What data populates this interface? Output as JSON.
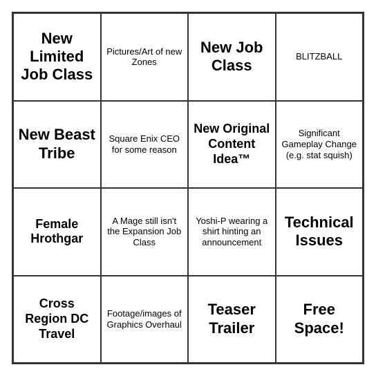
{
  "board": {
    "cells": [
      {
        "id": "r0c0",
        "text": "New Limited Job Class",
        "size": "large"
      },
      {
        "id": "r0c1",
        "text": "Pictures/Art of new Zones",
        "size": "normal"
      },
      {
        "id": "r0c2",
        "text": "New Job Class",
        "size": "large"
      },
      {
        "id": "r0c3",
        "text": "BLITZBALL",
        "size": "normal"
      },
      {
        "id": "r1c0",
        "text": "New Beast Tribe",
        "size": "large"
      },
      {
        "id": "r1c1",
        "text": "Square Enix CEO for some reason",
        "size": "normal"
      },
      {
        "id": "r1c2",
        "text": "New Original Content Idea™",
        "size": "medium-large"
      },
      {
        "id": "r1c3",
        "text": "Significant Gameplay Change (e.g. stat squish)",
        "size": "normal"
      },
      {
        "id": "r2c0",
        "text": "Female Hrothgar",
        "size": "medium-large"
      },
      {
        "id": "r2c1",
        "text": "A Mage still isn't the Expansion Job Class",
        "size": "normal"
      },
      {
        "id": "r2c2",
        "text": "Yoshi-P wearing a shirt hinting an announcement",
        "size": "normal"
      },
      {
        "id": "r2c3",
        "text": "Technical Issues",
        "size": "large"
      },
      {
        "id": "r3c0",
        "text": "Cross Region DC Travel",
        "size": "medium-large"
      },
      {
        "id": "r3c1",
        "text": "Footage/images of Graphics Overhaul",
        "size": "normal"
      },
      {
        "id": "r3c2",
        "text": "Teaser Trailer",
        "size": "large"
      },
      {
        "id": "r3c3",
        "text": "Free Space!",
        "size": "large"
      }
    ]
  }
}
